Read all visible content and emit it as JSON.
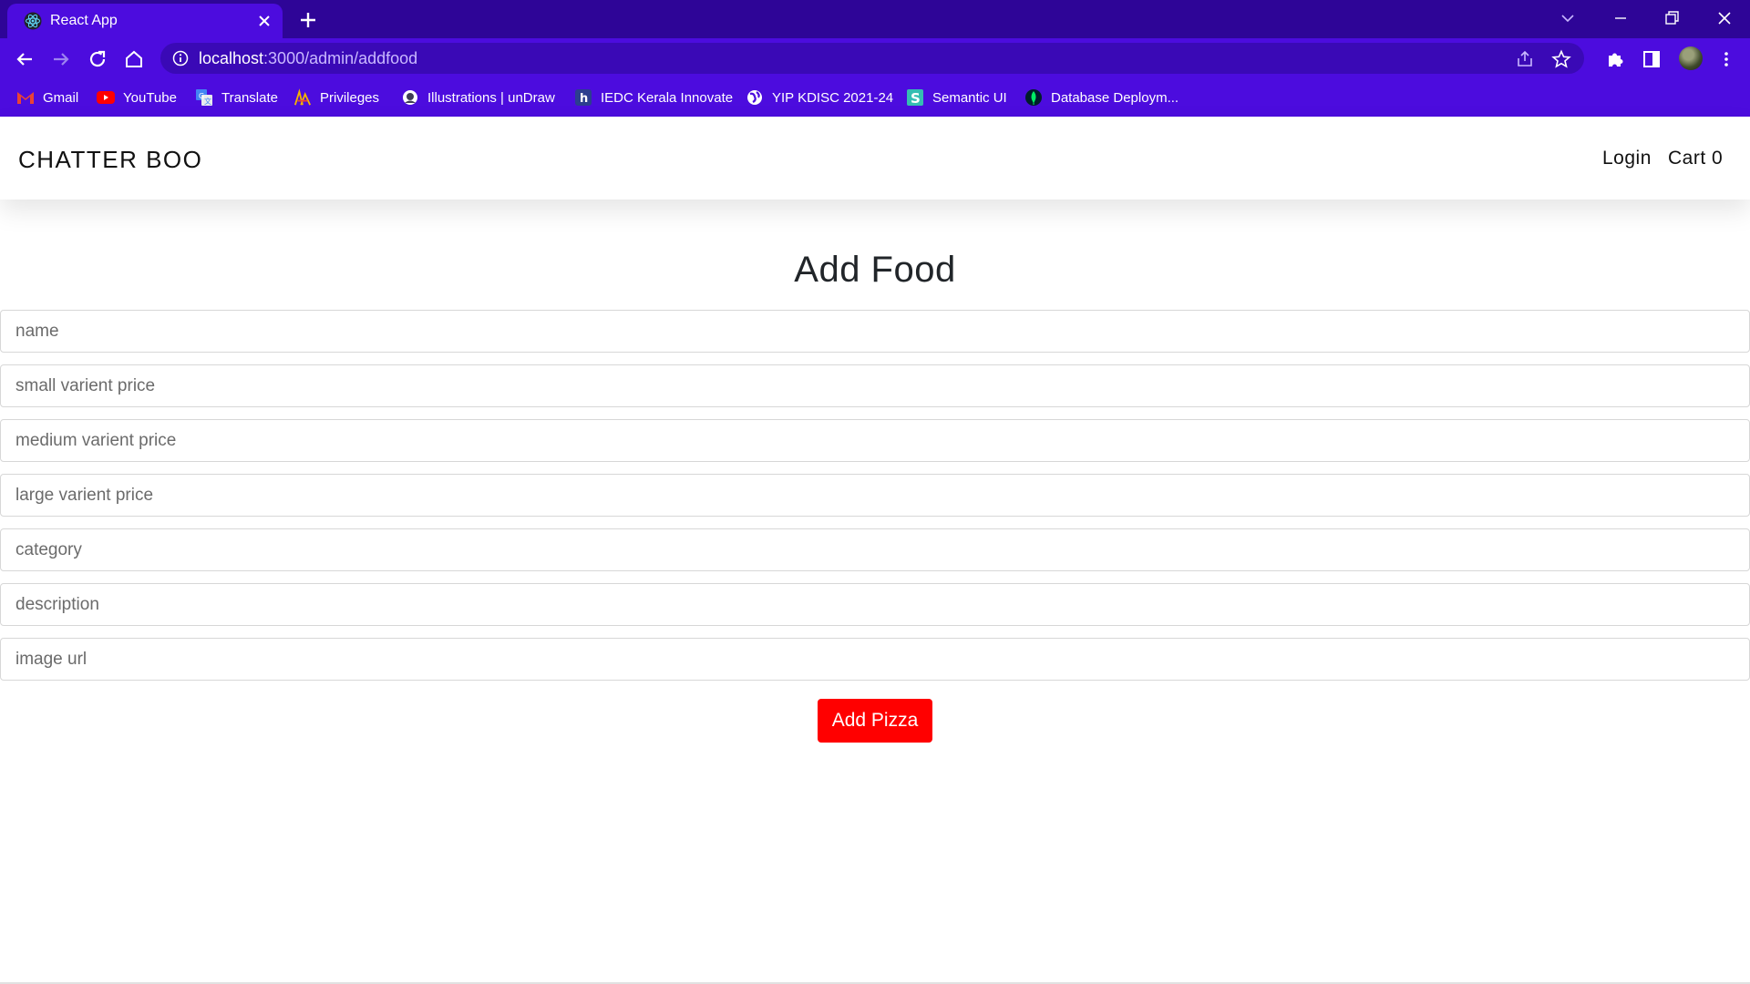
{
  "browser": {
    "tab": {
      "title": "React App",
      "favicon": "react-logo-icon"
    },
    "url": {
      "host": "localhost",
      "path": ":3000/admin/addfood"
    },
    "bookmarks": [
      {
        "label": "Gmail",
        "icon": "gmail-icon"
      },
      {
        "label": "YouTube",
        "icon": "youtube-icon"
      },
      {
        "label": "Translate",
        "icon": "google-translate-icon"
      },
      {
        "label": "Privileges",
        "icon": "privileges-icon"
      },
      {
        "label": "Illustrations | unDraw",
        "icon": "undraw-icon"
      },
      {
        "label": "IEDC Kerala Innovate",
        "icon": "iedc-icon"
      },
      {
        "label": "YIP KDISC 2021-24",
        "icon": "globe-icon"
      },
      {
        "label": "Semantic UI",
        "icon": "semantic-ui-icon"
      },
      {
        "label": "Database Deploym...",
        "icon": "mongodb-leaf-icon"
      }
    ],
    "colors": {
      "tabstrip": "#2e0597",
      "toolbar": "#4c0cde"
    }
  },
  "app": {
    "brand": "CHATTER BOO",
    "nav": {
      "login": "Login",
      "cart": "Cart 0"
    }
  },
  "form": {
    "title": "Add Food",
    "fields": [
      {
        "placeholder": "name",
        "value": ""
      },
      {
        "placeholder": "small varient price",
        "value": ""
      },
      {
        "placeholder": "medium varient price",
        "value": ""
      },
      {
        "placeholder": "large varient price",
        "value": ""
      },
      {
        "placeholder": "category",
        "value": ""
      },
      {
        "placeholder": "description",
        "value": ""
      },
      {
        "placeholder": "image url",
        "value": ""
      }
    ],
    "submit_label": "Add Pizza",
    "submit_color": "#ff0000"
  }
}
